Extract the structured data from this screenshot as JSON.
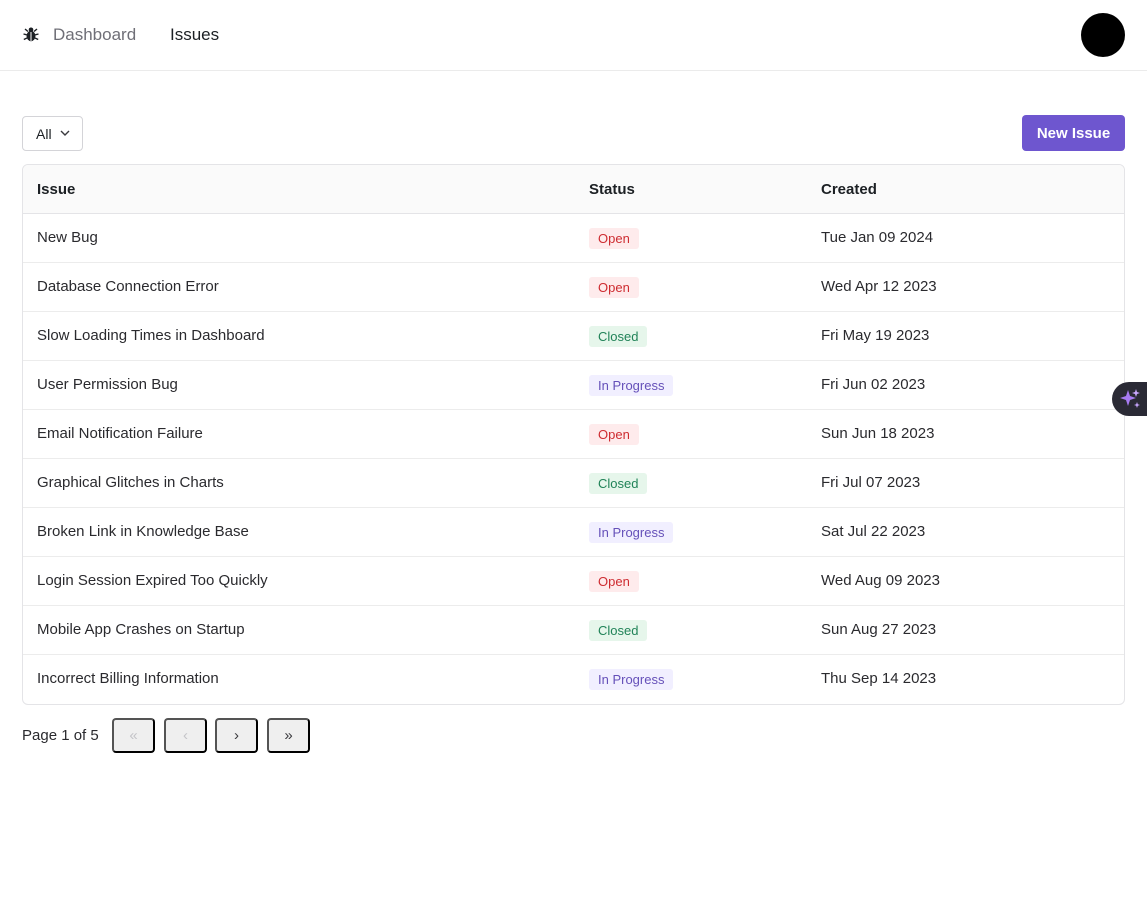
{
  "nav": {
    "dashboard_label": "Dashboard",
    "issues_label": "Issues"
  },
  "toolbar": {
    "filter_value": "All",
    "new_issue_label": "New Issue"
  },
  "table": {
    "headers": {
      "issue": "Issue",
      "status": "Status",
      "created": "Created"
    },
    "rows": [
      {
        "title": "New Bug",
        "status": "Open",
        "created": "Tue Jan 09 2024"
      },
      {
        "title": "Database Connection Error",
        "status": "Open",
        "created": "Wed Apr 12 2023"
      },
      {
        "title": "Slow Loading Times in Dashboard",
        "status": "Closed",
        "created": "Fri May 19 2023"
      },
      {
        "title": "User Permission Bug",
        "status": "In Progress",
        "created": "Fri Jun 02 2023"
      },
      {
        "title": "Email Notification Failure",
        "status": "Open",
        "created": "Sun Jun 18 2023"
      },
      {
        "title": "Graphical Glitches in Charts",
        "status": "Closed",
        "created": "Fri Jul 07 2023"
      },
      {
        "title": "Broken Link in Knowledge Base",
        "status": "In Progress",
        "created": "Sat Jul 22 2023"
      },
      {
        "title": "Login Session Expired Too Quickly",
        "status": "Open",
        "created": "Wed Aug 09 2023"
      },
      {
        "title": "Mobile App Crashes on Startup",
        "status": "Closed",
        "created": "Sun Aug 27 2023"
      },
      {
        "title": "Incorrect Billing Information",
        "status": "In Progress",
        "created": "Thu Sep 14 2023"
      }
    ]
  },
  "pagination": {
    "label": "Page 1 of 5",
    "first": "«",
    "prev": "‹",
    "next": "›",
    "last": "»"
  },
  "icons": {
    "logo": "bug-icon",
    "filter_chevron": "chevron-down-icon",
    "assistant": "sparkles-icon"
  },
  "colors": {
    "accent": "#6e56cf",
    "open": "#ce2c31",
    "closed": "#218358",
    "in_progress": "#6550b9"
  }
}
